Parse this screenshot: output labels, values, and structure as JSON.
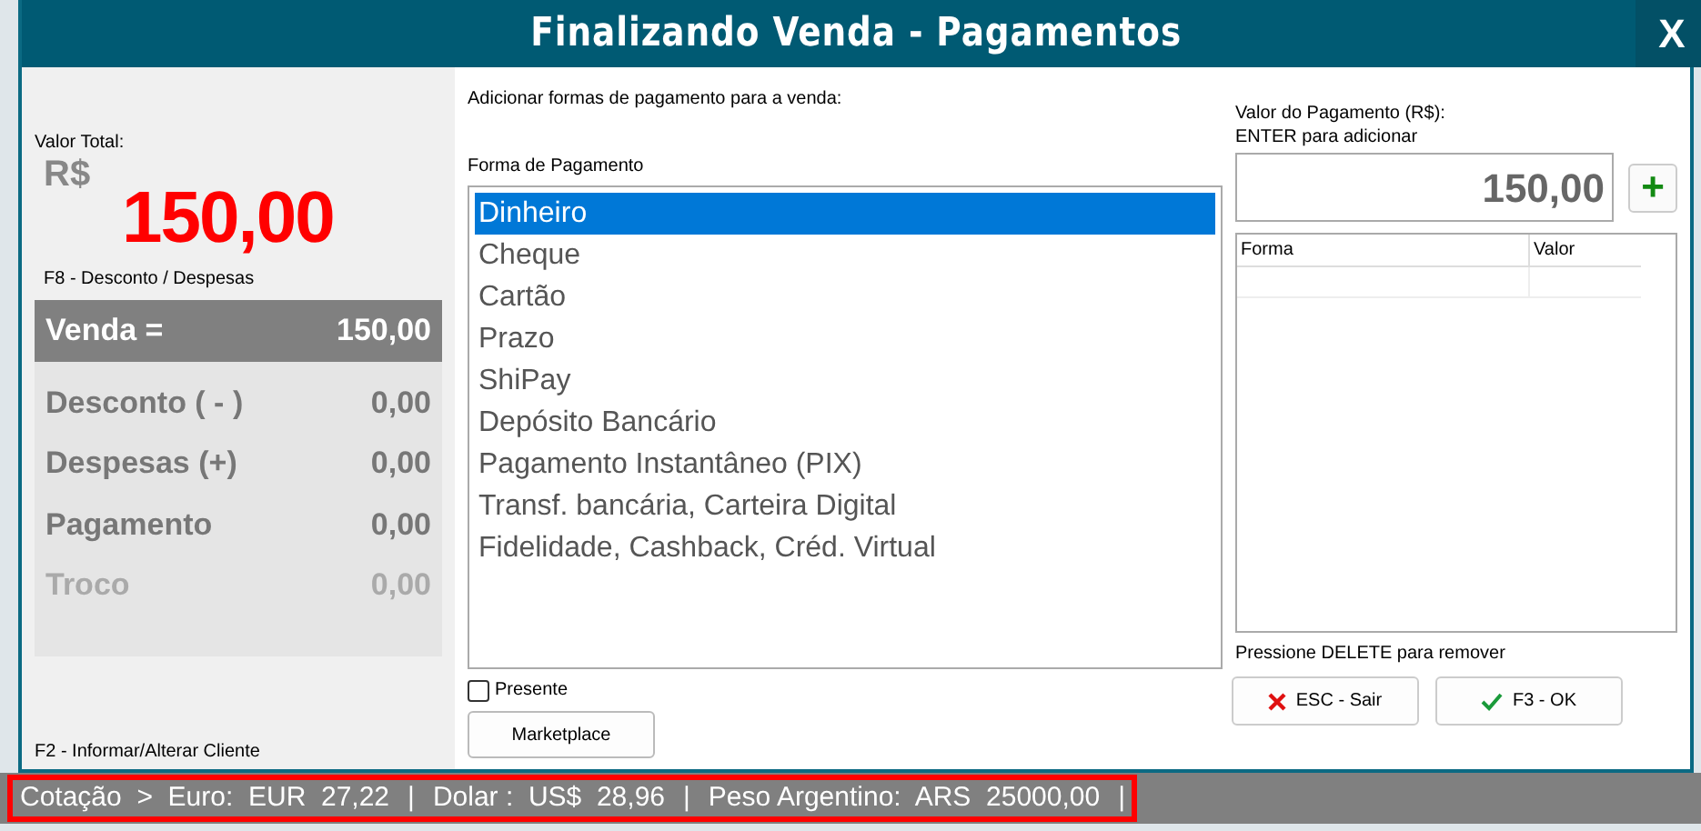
{
  "window": {
    "title": "Finalizando Venda - Pagamentos",
    "close": "X"
  },
  "summary": {
    "total_label": "Valor Total:",
    "currency": "R$",
    "total": "150,00",
    "discount_hint": "F8 - Desconto / Despesas",
    "rows": [
      {
        "kind": "header",
        "label": "Venda =",
        "value": "150,00"
      },
      {
        "kind": "normal",
        "label": "Desconto ( - )",
        "value": "0,00"
      },
      {
        "kind": "normal",
        "label": "Despesas (+)",
        "value": "0,00"
      },
      {
        "kind": "normal",
        "label": "Pagamento",
        "value": "0,00"
      },
      {
        "kind": "muted",
        "label": "Troco",
        "value": "0,00"
      }
    ],
    "client_hint": "F2 - Informar/Alterar Cliente"
  },
  "payment": {
    "intro": "Adicionar formas de pagamento para a venda:",
    "list_label": "Forma de Pagamento",
    "methods": [
      {
        "label": "Dinheiro",
        "selected": true
      },
      {
        "label": "Cheque",
        "selected": false
      },
      {
        "label": "Cartão",
        "selected": false
      },
      {
        "label": "Prazo",
        "selected": false
      },
      {
        "label": "ShiPay",
        "selected": false
      },
      {
        "label": "Depósito Bancário",
        "selected": false
      },
      {
        "label": "Pagamento Instantâneo (PIX)",
        "selected": false
      },
      {
        "label": "Transf. bancária, Carteira Digital",
        "selected": false
      },
      {
        "label": "Fidelidade, Cashback, Créd. Virtual",
        "selected": false
      }
    ],
    "gift": {
      "label": "Presente",
      "checked": false
    },
    "marketplace_button": "Marketplace"
  },
  "amount": {
    "label": "Valor do Pagamento (R$):",
    "hint": "ENTER para adicionar",
    "value": "150,00",
    "add_button": "+",
    "table": {
      "columns": [
        "Forma",
        "Valor"
      ]
    },
    "delete_hint": "Pressione DELETE para remover",
    "buttons": [
      {
        "kind": "cancel",
        "label": "ESC - Sair"
      },
      {
        "kind": "ok",
        "label": "F3 - OK"
      }
    ]
  },
  "status_bar": {
    "highlighted": true,
    "items": [
      "Cotação  >  Euro:  EUR  27,22",
      "|",
      "Dolar :  US$  28,96",
      "|",
      "Peso Argentino:  ARS  25000,00",
      "|"
    ]
  }
}
